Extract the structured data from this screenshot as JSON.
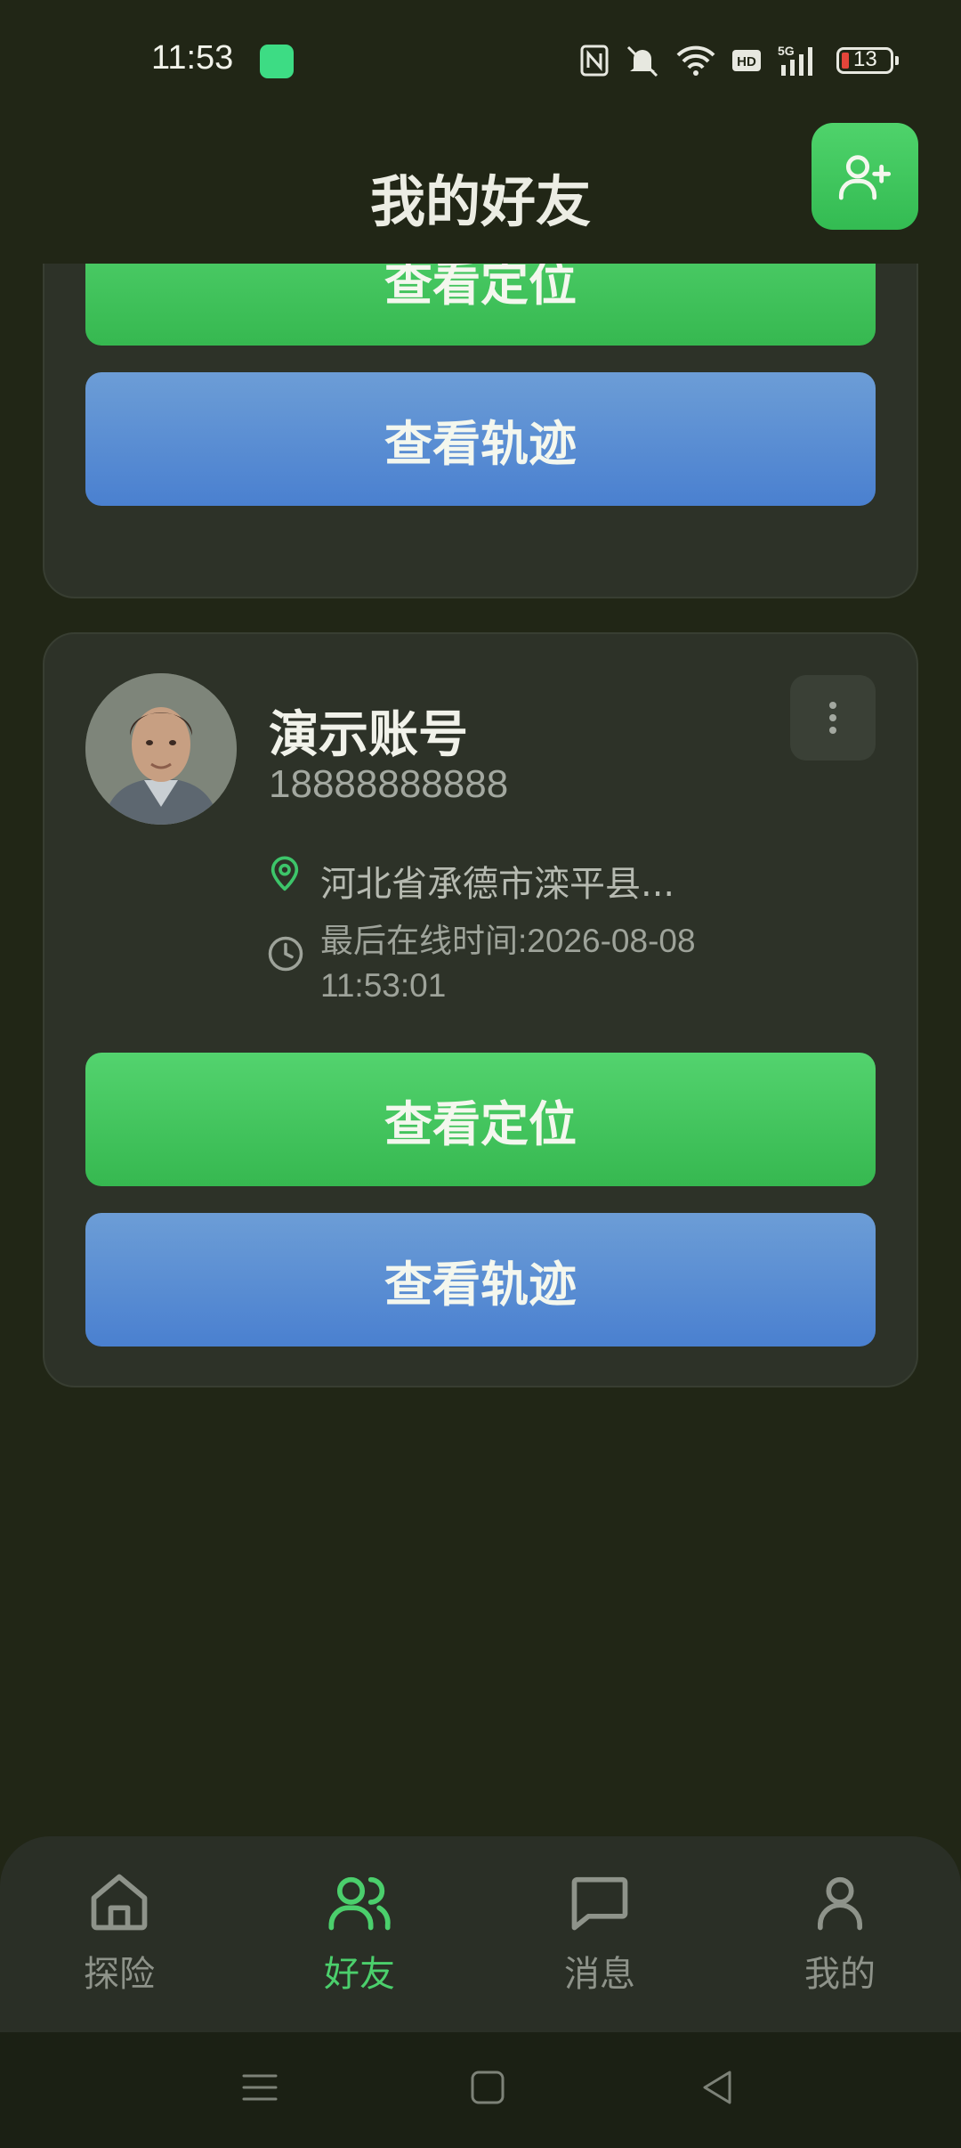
{
  "status_bar": {
    "time": "11:53",
    "battery": "13",
    "icons": [
      "android-app-icon",
      "nfc-icon",
      "mute-icon",
      "wifi-icon",
      "hd-icon",
      "signal-5g-icon",
      "battery-icon"
    ]
  },
  "header": {
    "title": "我的好友",
    "add_icon": "user-plus-icon"
  },
  "cards": [
    {
      "locate_label": "查看定位",
      "track_label": "查看轨迹"
    },
    {
      "name": "演示账号",
      "phone": "18888888888",
      "location": "河北省承德市滦平县...",
      "last_online": "最后在线时间:2026-08-08 11:53:01",
      "locate_label": "查看定位",
      "track_label": "查看轨迹",
      "more_icon": "more-vertical-icon",
      "location_icon": "map-pin-icon",
      "clock_icon": "clock-icon"
    }
  ],
  "bottom_nav": {
    "items": [
      {
        "label": "探险",
        "icon": "home-icon",
        "active": false
      },
      {
        "label": "好友",
        "icon": "friends-icon",
        "active": true
      },
      {
        "label": "消息",
        "icon": "message-icon",
        "active": false
      },
      {
        "label": "我的",
        "icon": "person-icon",
        "active": false
      }
    ]
  },
  "system_nav": [
    "menu-icon",
    "home-square-icon",
    "back-triangle-icon"
  ],
  "colors": {
    "background": "#212616",
    "card": "#2D3228",
    "accent_green": "#4BCF6C",
    "button_blue": "#5A8DD3"
  }
}
